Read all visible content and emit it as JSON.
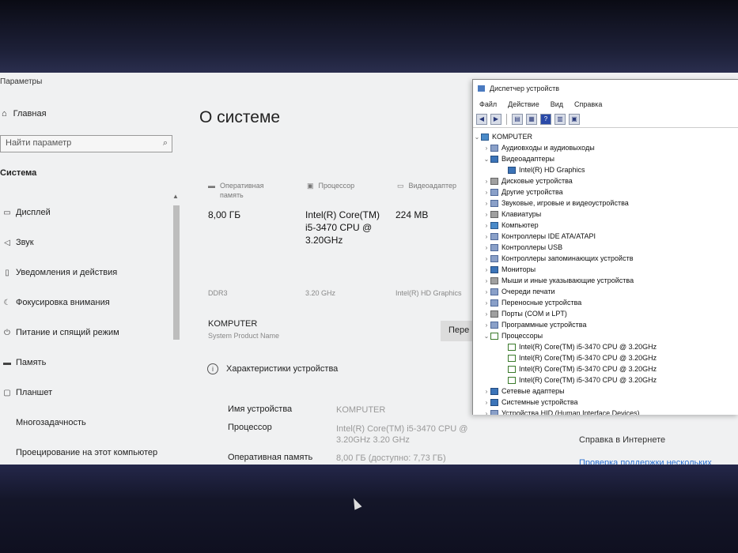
{
  "settings": {
    "window_title": "Параметры",
    "home_label": "Главная",
    "search_placeholder": "Найти параметр",
    "section_label": "Система",
    "nav": [
      {
        "label": "Дисплей",
        "icon": "display-icon"
      },
      {
        "label": "Звук",
        "icon": "sound-icon"
      },
      {
        "label": "Уведомления и действия",
        "icon": "notification-icon"
      },
      {
        "label": "Фокусировка внимания",
        "icon": "moon-icon"
      },
      {
        "label": "Питание и спящий режим",
        "icon": "power-icon"
      },
      {
        "label": "Память",
        "icon": "storage-icon"
      },
      {
        "label": "Планшет",
        "icon": "tablet-icon"
      },
      {
        "label": "Многозадачность",
        "icon": "multitask-icon"
      },
      {
        "label": "Проецирование на этот компьютер",
        "icon": "project-icon"
      }
    ]
  },
  "about": {
    "title": "О системе",
    "specs": [
      {
        "head": "Оперативная память",
        "value": "8,00 ГБ",
        "sub": "DDR3"
      },
      {
        "head": "Процессор",
        "value": "Intel(R) Core(TM) i5-3470 CPU @ 3.20GHz",
        "sub": "3.20 GHz"
      },
      {
        "head": "Видеоадаптер",
        "value": "224 MB",
        "sub": "Intel(R) HD Graphics"
      }
    ],
    "pc_name": "KOMPUTER",
    "pc_sub": "System Product Name",
    "rename_label": "Пере",
    "device_specs_title": "Характеристики устройства",
    "rows": [
      {
        "label": "Имя устройства",
        "value": "KOMPUTER"
      },
      {
        "label": "Процессор",
        "value": "Intel(R) Core(TM) i5-3470 CPU @ 3.20GHz 3.20 GHz"
      },
      {
        "label": "Оперативная память",
        "value": "8,00 ГБ (доступно: 7,73 ГБ)"
      }
    ],
    "help_title": "Справка в Интернете",
    "help_link": "Проверка поддержки нескольких"
  },
  "devmgr": {
    "title": "Диспетчер устройств",
    "menu": [
      "Файл",
      "Действие",
      "Вид",
      "Справка"
    ],
    "root": "KOMPUTER",
    "tree": [
      {
        "label": "Аудиовходы и аудиовыходы",
        "expanded": false,
        "level": 1,
        "icon": "gen"
      },
      {
        "label": "Видеоадаптеры",
        "expanded": true,
        "level": 1,
        "icon": "disp"
      },
      {
        "label": "Intel(R) HD Graphics",
        "level": 2,
        "icon": "disp"
      },
      {
        "label": "Дисковые устройства",
        "expanded": false,
        "level": 1,
        "icon": "grey"
      },
      {
        "label": "Другие устройства",
        "expanded": false,
        "level": 1,
        "icon": "gen"
      },
      {
        "label": "Звуковые, игровые и видеоустройства",
        "expanded": false,
        "level": 1,
        "icon": "gen"
      },
      {
        "label": "Клавиатуры",
        "expanded": false,
        "level": 1,
        "icon": "grey"
      },
      {
        "label": "Компьютер",
        "expanded": false,
        "level": 1,
        "icon": "pc"
      },
      {
        "label": "Контроллеры IDE ATA/ATAPI",
        "expanded": false,
        "level": 1,
        "icon": "gen"
      },
      {
        "label": "Контроллеры USB",
        "expanded": false,
        "level": 1,
        "icon": "gen"
      },
      {
        "label": "Контроллеры запоминающих устройств",
        "expanded": false,
        "level": 1,
        "icon": "gen"
      },
      {
        "label": "Мониторы",
        "expanded": false,
        "level": 1,
        "icon": "disp"
      },
      {
        "label": "Мыши и иные указывающие устройства",
        "expanded": false,
        "level": 1,
        "icon": "grey"
      },
      {
        "label": "Очереди печати",
        "expanded": false,
        "level": 1,
        "icon": "gen"
      },
      {
        "label": "Переносные устройства",
        "expanded": false,
        "level": 1,
        "icon": "gen"
      },
      {
        "label": "Порты (COM и LPT)",
        "expanded": false,
        "level": 1,
        "icon": "grey"
      },
      {
        "label": "Программные устройства",
        "expanded": false,
        "level": 1,
        "icon": "gen"
      },
      {
        "label": "Процессоры",
        "expanded": true,
        "level": 1,
        "icon": "cpu"
      },
      {
        "label": "Intel(R) Core(TM) i5-3470 CPU @ 3.20GHz",
        "level": 2,
        "icon": "cpu"
      },
      {
        "label": "Intel(R) Core(TM) i5-3470 CPU @ 3.20GHz",
        "level": 2,
        "icon": "cpu"
      },
      {
        "label": "Intel(R) Core(TM) i5-3470 CPU @ 3.20GHz",
        "level": 2,
        "icon": "cpu"
      },
      {
        "label": "Intel(R) Core(TM) i5-3470 CPU @ 3.20GHz",
        "level": 2,
        "icon": "cpu"
      },
      {
        "label": "Сетевые адаптеры",
        "expanded": false,
        "level": 1,
        "icon": "disp"
      },
      {
        "label": "Системные устройства",
        "expanded": false,
        "level": 1,
        "icon": "disp"
      },
      {
        "label": "Устройства HID (Human Interface Devices)",
        "expanded": false,
        "level": 1,
        "icon": "gen"
      }
    ]
  }
}
